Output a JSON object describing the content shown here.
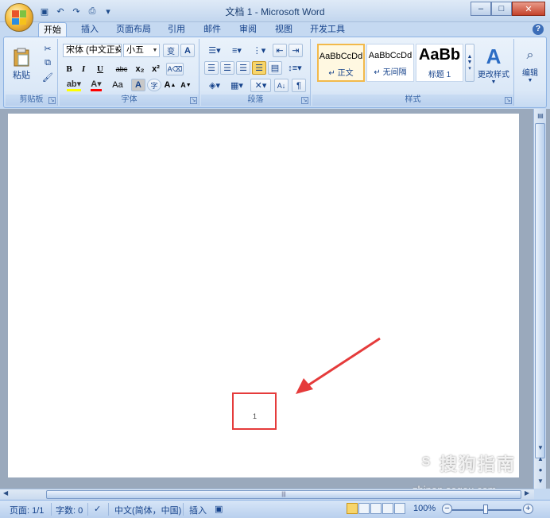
{
  "window": {
    "title": "文档 1 - Microsoft Word",
    "controls": {
      "minimize": "–",
      "maximize": "□",
      "close": "✕"
    }
  },
  "quick_access": [
    "save-icon",
    "undo-icon",
    "redo-icon",
    "print-preview-icon",
    "customize-icon"
  ],
  "tabs": [
    {
      "label": "开始",
      "active": true
    },
    {
      "label": "插入"
    },
    {
      "label": "页面布局"
    },
    {
      "label": "引用"
    },
    {
      "label": "邮件"
    },
    {
      "label": "审阅"
    },
    {
      "label": "视图"
    },
    {
      "label": "开发工具"
    }
  ],
  "ribbon": {
    "clipboard": {
      "label": "剪贴板",
      "paste": "粘贴"
    },
    "font": {
      "label": "字体",
      "font_name": "宋体 (中文正文",
      "font_size": "小五",
      "bold": "B",
      "italic": "I",
      "underline": "U",
      "strike": "abc",
      "subscript": "x₂",
      "superscript": "x²",
      "grow": "A",
      "shrink": "A",
      "case": "Aa",
      "phonetic": "变",
      "border_char": "A",
      "enclose": "字"
    },
    "paragraph": {
      "label": "段落"
    },
    "styles": {
      "label": "样式",
      "items": [
        {
          "sample": "AaBbCcDd",
          "name": "↵ 正文"
        },
        {
          "sample": "AaBbCcDd",
          "name": "↵ 无间隔"
        },
        {
          "sample": "AaBb",
          "name": "标题 1"
        }
      ],
      "change_styles": "更改样式"
    },
    "editing": {
      "label": "编辑"
    }
  },
  "document": {
    "page_number": "1"
  },
  "watermark": {
    "brand": "搜狗指南",
    "url": "zhinan.sogou.com"
  },
  "statusbar": {
    "page": "页面: 1/1",
    "words": "字数: 0",
    "language": "中文(简体，中国)",
    "mode": "插入",
    "zoom": "100%",
    "zoom_minus": "−",
    "zoom_plus": "+"
  },
  "colors": {
    "highlight_box": "#e53b3b",
    "arrow": "#e53b3b",
    "ribbon": "#dbe8f7"
  }
}
